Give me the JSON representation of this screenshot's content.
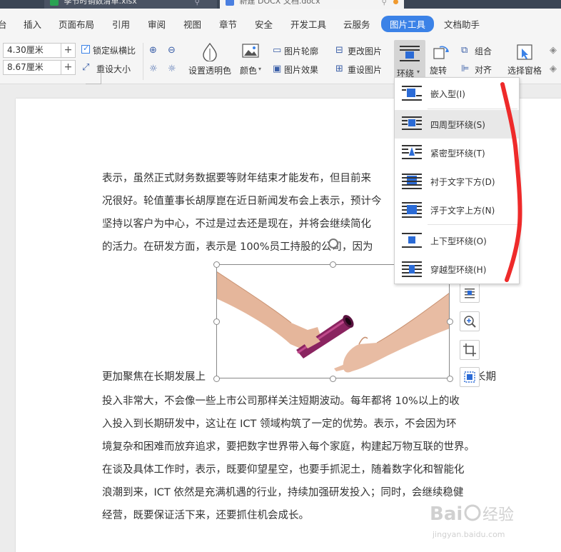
{
  "titlebar": {
    "left_fragment": "台",
    "tabs": [
      {
        "label": "季节时销数清单.xlsx"
      },
      {
        "label": "新建 DOCX 文档.docx"
      }
    ]
  },
  "menu": {
    "items": [
      "台",
      "插入",
      "页面布局",
      "引用",
      "审阅",
      "视图",
      "章节",
      "安全",
      "开发工具",
      "云服务",
      "图片工具",
      "文档助手"
    ],
    "active": "图片工具"
  },
  "ribbon": {
    "width_value": "4.30厘米",
    "height_value": "8.67厘米",
    "lock_ratio_label": "锁定纵横比",
    "reset_size_label": "重设大小",
    "transparent_label": "设置透明色",
    "color_label": "颜色",
    "outline_label": "图片轮廓",
    "effect_label": "图片效果",
    "change_pic_label": "更改图片",
    "reset_pic_label": "重设图片",
    "wrap_label": "环绕",
    "rotate_label": "旋转",
    "group_label": "组合",
    "align_label": "对齐",
    "selection_pane_label": "选择窗格"
  },
  "dropdown": {
    "items": [
      {
        "label": "嵌入型(I)"
      },
      {
        "label": "四周型环绕(S)"
      },
      {
        "label": "紧密型环绕(T)"
      },
      {
        "label": "衬于文字下方(D)"
      },
      {
        "label": "浮于文字上方(N)"
      },
      {
        "label": "上下型环绕(O)"
      },
      {
        "label": "穿越型环绕(H)"
      }
    ],
    "hovered": "四周型环绕(S)"
  },
  "document": {
    "lines_top": [
      "表示，虽然正式财务数据要等财年结束才能发布，但目前来",
      "况很好。轮值董事长胡厚崑在近日新闻发布会上表示，预计今",
      "坚持以客户为中心，不过是过去还是现在，并将会继续简化",
      "的活力。在研发方面，表示是 100%员工持股的公司，因为"
    ],
    "line_mid_left": "更加聚焦在长期发展上",
    "line_mid_right": "长期",
    "lines_bottom": [
      "投入非常大，不会像一些上市公司那样关注短期波动。每年都将 10%以上的收",
      "入投入到长期研发中，这让在 ICT 领域构筑了一定的优势。表示，不会因为环",
      "境复杂和困难而放弃追求，要把数字世界带入每个家庭，构建起万物互联的世界。",
      "在谈及具体工作时，表示，既要仰望星空，也要手抓泥土，随着数字化和智能化",
      "浪潮到来，ICT 依然是充满机遇的行业，持续加强研发投入；同时，会继续稳健",
      "经营，既要保证活下来，还要抓住机会成长。"
    ]
  },
  "watermark": {
    "brand": "Baidu 经验",
    "url": "jingyan.baidu.com"
  },
  "colors": {
    "accent": "#3b82e7",
    "scribble": "#ee2a2a",
    "tab_bar": "#3b4554"
  }
}
